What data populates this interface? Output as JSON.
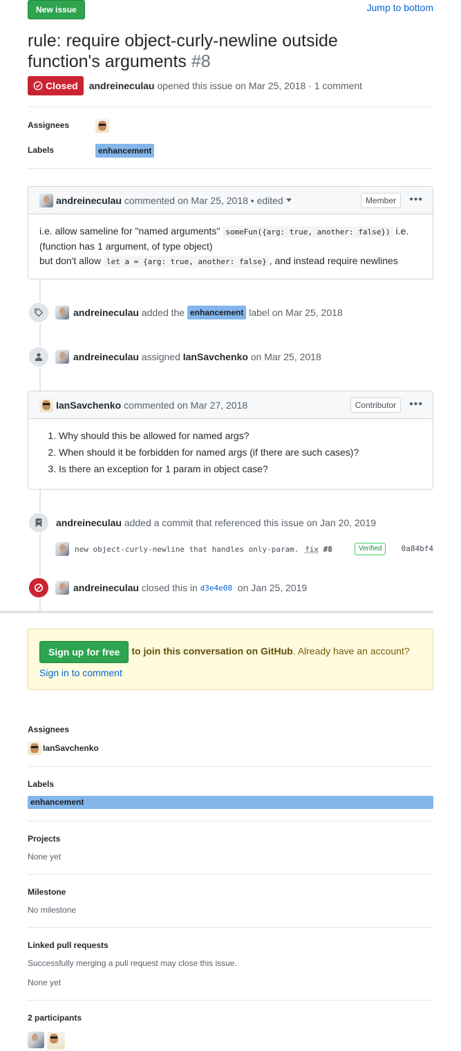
{
  "header": {
    "new_issue_label": "New issue",
    "jump_label": "Jump to bottom"
  },
  "issue": {
    "title": "rule: require object-curly-newline outside function's arguments",
    "number": "#8",
    "state": "Closed",
    "author": "andreineculau",
    "opened_text": "opened this issue on Mar 25, 2018 · 1 comment"
  },
  "top_sidebar": {
    "assignees_label": "Assignees",
    "labels_label": "Labels",
    "label_name": "enhancement"
  },
  "comment1": {
    "author": "andreineculau",
    "meta": "commented on Mar 25, 2018 • edited",
    "role": "Member",
    "line1_a": "i.e. allow sameline for \"named arguments\" ",
    "line1_code": "someFun({arg: true, another: false})",
    "line1_b": " i.e. (function has 1 argument, of type object)",
    "line2_a": "but don't allow ",
    "line2_code": "let a = {arg: true, another: false}",
    "line2_b": ", and instead require newlines"
  },
  "event_label": {
    "actor": "andreineculau",
    "text_a": "added the",
    "label": "enhancement",
    "text_b": "label on Mar 25, 2018"
  },
  "event_assign": {
    "actor": "andreineculau",
    "text_a": "assigned",
    "assignee": "IanSavchenko",
    "text_b": "on Mar 25, 2018"
  },
  "comment2": {
    "author": "IanSavchenko",
    "meta": "commented on Mar 27, 2018",
    "role": "Contributor",
    "items": [
      "Why should this be allowed for named args?",
      "When should it be forbidden for named args (if there are such cases)?",
      "Is there an exception for 1 param in object case?"
    ]
  },
  "event_commit": {
    "actor": "andreineculau",
    "text": "added a commit that referenced this issue on Jan 20, 2019",
    "commit_message": "new object-curly-newline that handles only-param.",
    "fix": "fix",
    "fix_ref": "#8",
    "verified": "Verified",
    "sha": "0a84bf4"
  },
  "event_closed": {
    "actor": "andreineculau",
    "text_a": "closed this in",
    "commit": "d3e4e08",
    "text_b": "on Jan 25, 2019"
  },
  "signup": {
    "button": "Sign up for free",
    "text": "to join this conversation on GitHub",
    "text2": ". Already have an account? ",
    "link": "Sign in to comment"
  },
  "sidebar": {
    "assignees_label": "Assignees",
    "assignee": "IanSavchenko",
    "labels_label": "Labels",
    "label": "enhancement",
    "projects_label": "Projects",
    "projects_value": "None yet",
    "milestone_label": "Milestone",
    "milestone_value": "No milestone",
    "linked_label": "Linked pull requests",
    "linked_desc": "Successfully merging a pull request may close this issue.",
    "linked_value": "None yet",
    "participants_label": "2 participants"
  },
  "colors": {
    "closed_red": "#cb2431",
    "green_button": "#2ea44f",
    "label_blue": "#84b6eb",
    "link_blue": "#0366d6"
  }
}
